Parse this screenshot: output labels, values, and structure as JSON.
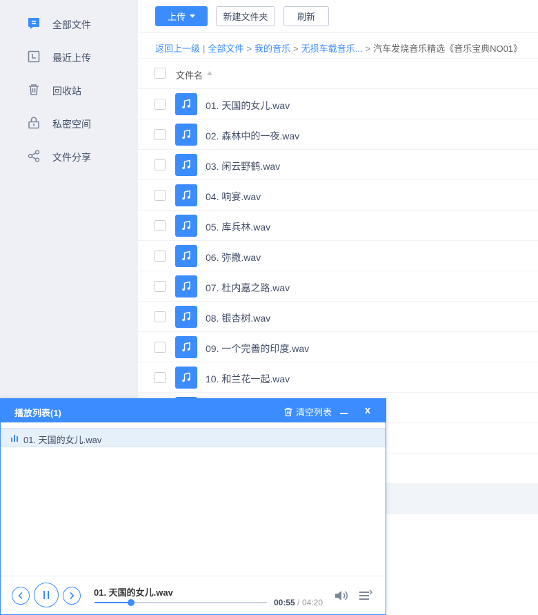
{
  "sidebar": {
    "items": [
      {
        "label": "全部文件",
        "icon": "file-list-icon",
        "active": true
      },
      {
        "label": "最近上传",
        "icon": "clock-icon"
      },
      {
        "label": "回收站",
        "icon": "trash-icon"
      },
      {
        "label": "私密空间",
        "icon": "lock-icon"
      },
      {
        "label": "文件分享",
        "icon": "share-icon"
      }
    ]
  },
  "toolbar": {
    "upload_label": "上传",
    "new_folder_label": "新建文件夹",
    "refresh_label": "刷新"
  },
  "breadcrumb": {
    "back": "返回上一级",
    "pipe": "|",
    "sep": ">",
    "items": [
      "全部文件",
      "我的音乐",
      "无损车载音乐..."
    ],
    "current": "汽车发烧音乐精选《音乐宝典NO01》"
  },
  "file_list": {
    "column_name": "文件名",
    "files": [
      "01. 天国的女儿.wav",
      "02. 森林中的一夜.wav",
      "03. 闲云野鹤.wav",
      "04. 响宴.wav",
      "05. 库兵林.wav",
      "06. 弥撒.wav",
      "07. 杜内嘉之路.wav",
      "08. 银杏树.wav",
      "09. 一个完善的印度.wav",
      "10. 和兰花一起.wav"
    ]
  },
  "player": {
    "title": "播放列表(1)",
    "clear_label": "清空列表",
    "close_label": "x",
    "playlist": [
      "01. 天国的女儿.wav"
    ],
    "now_playing": "01. 天国的女儿.wav",
    "time_current": "00:55",
    "time_sep": "/",
    "time_total": "04:20",
    "progress_fraction": 0.2115
  },
  "colors": {
    "accent": "#3b8cff",
    "sidebar_bg": "#eef0f6",
    "text": "#424e67"
  }
}
